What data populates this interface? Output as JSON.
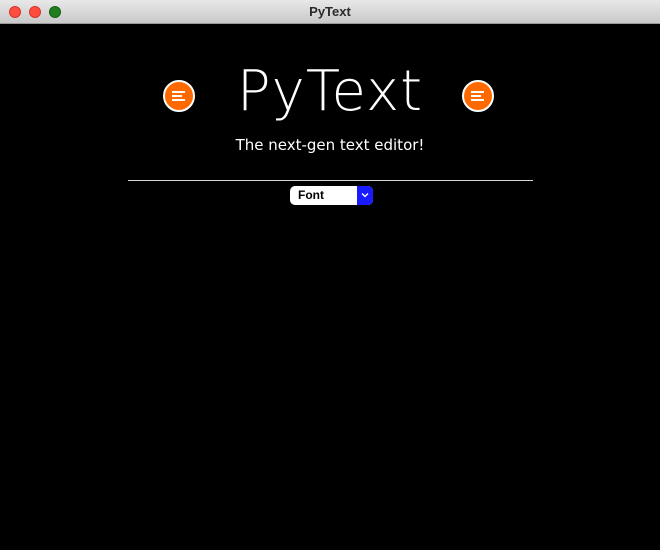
{
  "window": {
    "title": "PyText"
  },
  "header": {
    "app_title": "PyText",
    "subtitle": "The next-gen text editor!"
  },
  "toolbar": {
    "font_select": {
      "selected": "Font"
    }
  },
  "icons": {
    "left_menu": "menu-icon",
    "right_menu": "menu-icon",
    "dropdown": "chevron-down-icon"
  },
  "colors": {
    "background": "#000000",
    "menu_button": "#ff6a00",
    "select_arrow": "#1a1aff",
    "text": "#ffffff"
  }
}
